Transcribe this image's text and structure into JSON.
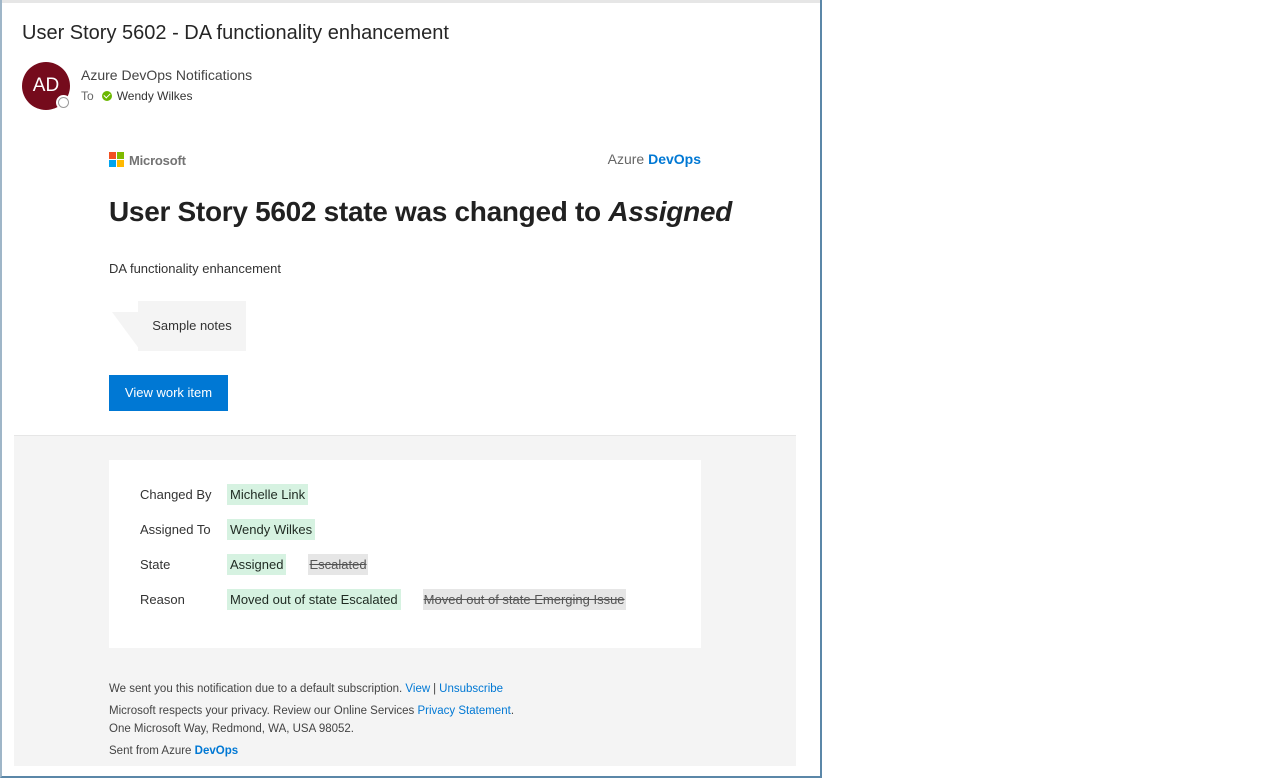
{
  "email": {
    "subject": "User Story 5602 - DA functionality enhancement",
    "sender_initials": "AD",
    "sender_name": "Azure DevOps Notifications",
    "to_label": "To",
    "to_name": "Wendy Wilkes",
    "avatar_color": "#750b1c"
  },
  "body": {
    "ms_logo_text": "Microsoft",
    "brand_prefix": "Azure",
    "brand_name": "DevOps",
    "headline_prefix": "User Story 5602 state was changed to",
    "headline_state": "Assigned",
    "workitem_title": "DA functionality enhancement",
    "note": "Sample notes",
    "view_button": "View work item",
    "accent_color": "#0078d4"
  },
  "details": {
    "changed_by_label": "Changed By",
    "changed_by": "Michelle Link",
    "assigned_to_label": "Assigned To",
    "assigned_to": "Wendy Wilkes",
    "state_label": "State",
    "state_new": "Assigned",
    "state_old": "Escalated",
    "reason_label": "Reason",
    "reason_new": "Moved out of state Escalated",
    "reason_old": "Moved out of state Emerging Issue"
  },
  "footer": {
    "line1": "We sent you this notification due to a default subscription.",
    "view_link": "View",
    "separator": "|",
    "unsubscribe_link": "Unsubscribe",
    "privacy_text": "Microsoft respects your privacy. Review our Online Services",
    "privacy_link": "Privacy Statement",
    "privacy_end": ".",
    "address": "One Microsoft Way, Redmond, WA, USA 98052.",
    "sent_from_prefix": "Sent from Azure",
    "sent_from_brand": "DevOps"
  }
}
